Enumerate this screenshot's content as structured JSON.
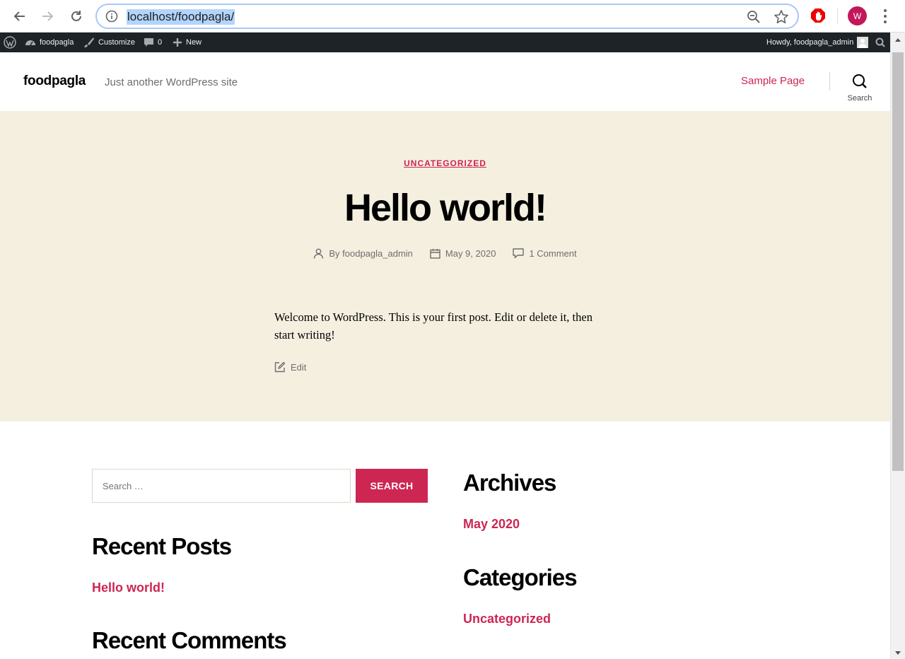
{
  "browser": {
    "url": "localhost/foodpagla/",
    "avatar_letter": "W",
    "accent": "#a8c7fa",
    "avatar_color": "#c2185b"
  },
  "admin_bar": {
    "site_name": "foodpagla",
    "customize": "Customize",
    "comments_count": "0",
    "new": "New",
    "howdy": "Howdy, foodpagla_admin"
  },
  "header": {
    "site_title": "foodpagla",
    "tagline": "Just another WordPress site",
    "nav": [
      "Sample Page"
    ],
    "search_label": "Search"
  },
  "post": {
    "category": "UNCATEGORIZED",
    "title": "Hello world!",
    "author": "By foodpagla_admin",
    "date": "May 9, 2020",
    "comments": "1 Comment",
    "content": "Welcome to WordPress. This is your first post. Edit or delete it, then start writing!",
    "edit": "Edit",
    "hero_bg": "#f5efe0",
    "accent": "#cd2653"
  },
  "widgets": {
    "search": {
      "placeholder": "Search …",
      "button": "SEARCH"
    },
    "recent_posts": {
      "title": "Recent Posts",
      "items": [
        "Hello world!"
      ]
    },
    "recent_comments": {
      "title": "Recent Comments"
    },
    "archives": {
      "title": "Archives",
      "items": [
        "May 2020"
      ]
    },
    "categories": {
      "title": "Categories",
      "items": [
        "Uncategorized"
      ]
    }
  }
}
